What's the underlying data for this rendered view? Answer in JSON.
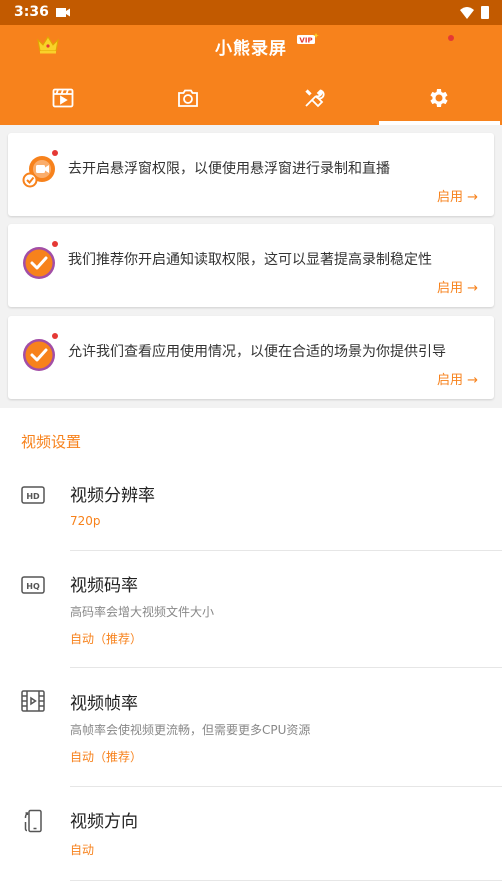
{
  "status_bar": {
    "time": "3:36"
  },
  "app_bar": {
    "title": "小熊录屏",
    "vip_badge": "VIP"
  },
  "tabs": [
    {
      "icon": "video-list-icon"
    },
    {
      "icon": "camera-icon"
    },
    {
      "icon": "tools-icon"
    },
    {
      "icon": "gear-icon",
      "active": true
    }
  ],
  "permissions": [
    {
      "text": "去开启悬浮窗权限，以便使用悬浮窗进行录制和直播",
      "action": "启用 →",
      "icon": "floating-window-icon"
    },
    {
      "text": "我们推荐你开启通知读取权限，这可以显著提高录制稳定性",
      "action": "启用 →",
      "icon": "check-circle-icon"
    },
    {
      "text": "允许我们查看应用使用情况，以便在合适的场景为你提供引导",
      "action": "启用 →",
      "icon": "check-circle-icon"
    }
  ],
  "video_settings": {
    "title": "视频设置",
    "items": [
      {
        "name": "视频分辨率",
        "desc": "",
        "value": "720p",
        "icon": "hd-icon"
      },
      {
        "name": "视频码率",
        "desc": "高码率会增大视频文件大小",
        "value": "自动（推荐）",
        "icon": "hq-icon"
      },
      {
        "name": "视频帧率",
        "desc": "高帧率会使视频更流畅，但需要更多CPU资源",
        "value": "自动（推荐）",
        "icon": "film-icon"
      },
      {
        "name": "视频方向",
        "desc": "",
        "value": "自动",
        "icon": "screen-rotate-icon"
      }
    ]
  },
  "colors": {
    "accent": "#f7821c",
    "status_bar": "#c25a00",
    "badge_dot": "#e53935"
  }
}
